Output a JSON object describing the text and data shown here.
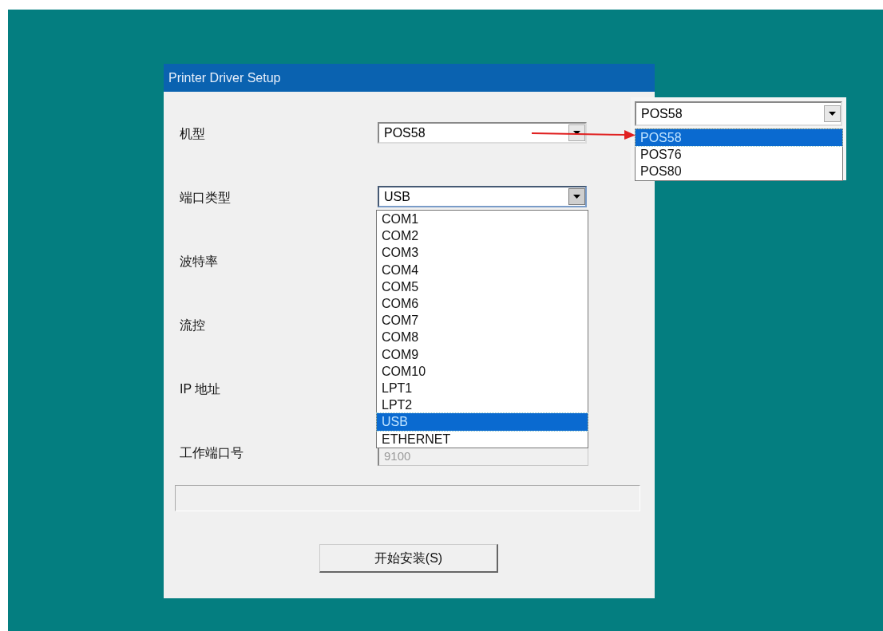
{
  "window": {
    "title": "Printer Driver Setup"
  },
  "fields": [
    {
      "label": "机型",
      "kind": "combo",
      "value": "POS58",
      "expanded": false
    },
    {
      "label": "端口类型",
      "kind": "combo",
      "value": "USB",
      "expanded": true
    },
    {
      "label": "波特率",
      "kind": "covered"
    },
    {
      "label": "流控",
      "kind": "covered"
    },
    {
      "label": "IP 地址",
      "kind": "covered"
    },
    {
      "label": "工作端口号",
      "kind": "text",
      "value": "9100",
      "disabled": true
    }
  ],
  "port_list": {
    "items": [
      {
        "label": "COM1",
        "selected": false
      },
      {
        "label": "COM2",
        "selected": false
      },
      {
        "label": "COM3",
        "selected": false
      },
      {
        "label": "COM4",
        "selected": false
      },
      {
        "label": "COM5",
        "selected": false
      },
      {
        "label": "COM6",
        "selected": false
      },
      {
        "label": "COM7",
        "selected": false
      },
      {
        "label": "COM8",
        "selected": false
      },
      {
        "label": "COM9",
        "selected": false
      },
      {
        "label": "COM10",
        "selected": false
      },
      {
        "label": "LPT1",
        "selected": false
      },
      {
        "label": "LPT2",
        "selected": false
      },
      {
        "label": "USB",
        "selected": true
      },
      {
        "label": "ETHERNET",
        "selected": false
      }
    ]
  },
  "progress": {
    "level": 0
  },
  "install_button": {
    "label": "开始安装(S)"
  },
  "callout": {
    "value": "POS58",
    "items": [
      {
        "label": "POS58",
        "selected": true
      },
      {
        "label": "POS76",
        "selected": false
      },
      {
        "label": "POS80",
        "selected": false
      }
    ]
  }
}
